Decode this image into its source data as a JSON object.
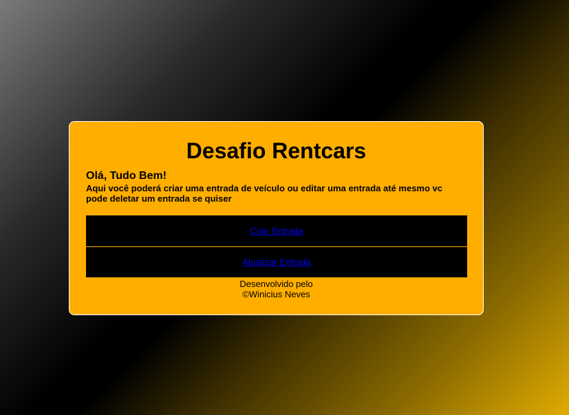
{
  "card": {
    "title": "Desafio Rentcars",
    "greeting": "Olá, Tudo Bem!",
    "description": "Aqui você poderá criar uma entrada de veículo ou editar uma entrada até mesmo vc pode deletar um entrada se quiser"
  },
  "actions": {
    "create_label": "Criar Entrada",
    "update_label": "Atualizar Entrada"
  },
  "footer": {
    "line1": "Desenvolvido pelo",
    "line2": "©Winicius Neves"
  },
  "colors": {
    "card_background": "#ffae00",
    "button_background": "#000000",
    "link": "#0000ee"
  }
}
